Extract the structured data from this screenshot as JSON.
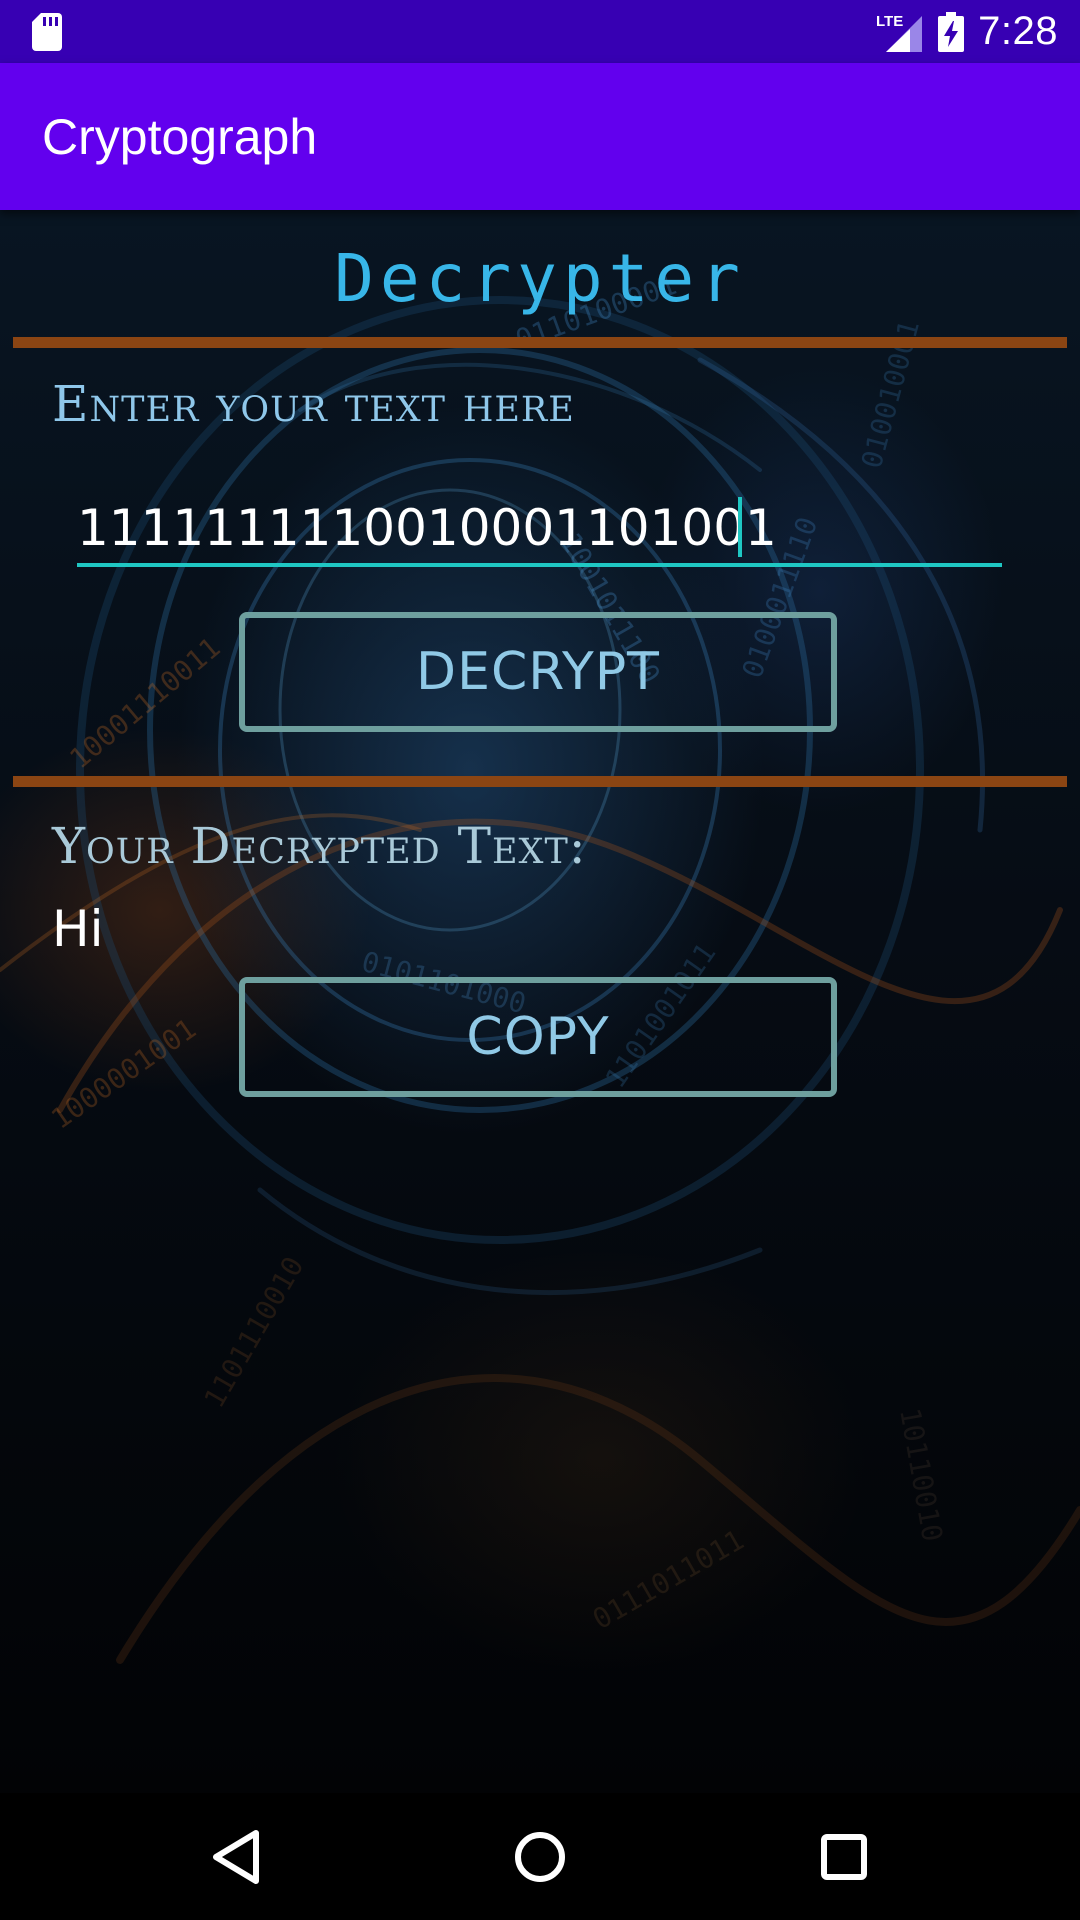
{
  "status_bar": {
    "time": "7:28",
    "network": "LTE",
    "icons": [
      "sd-card-icon",
      "lte-signal-icon",
      "battery-charging-icon"
    ]
  },
  "app_bar": {
    "title": "Cryptograph"
  },
  "main": {
    "heading": "Decrypter",
    "input_label": "Enter your text here",
    "input_value": "1111111110010001101001",
    "decrypt_label": "DECRYPT",
    "output_label": "Your Decrypted Text:",
    "output_value": "Hi",
    "copy_label": "COPY"
  },
  "nav_bar": {
    "icons": [
      "back-icon",
      "home-icon",
      "recents-icon"
    ]
  },
  "colors": {
    "status_bar": "#3700b3",
    "app_bar": "#6200ee",
    "heading": "#38b6e8",
    "divider": "#8b4513",
    "input_underline": "#1fc7c3",
    "button_border": "#6e9f9e",
    "button_text": "#90c9e6"
  }
}
